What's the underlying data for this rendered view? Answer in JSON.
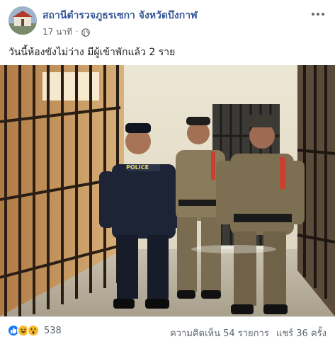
{
  "post": {
    "page_name": "สถานีตำรวจภูธรเซกา จังหวัดบึงกาฬ",
    "timestamp": "17 นาที",
    "visibility_icon": "globe-icon",
    "text": "วันนี้ห้องขังไม่ว่าง มีผู้เข้าพักแล้ว 2 ราย"
  },
  "photo": {
    "shirt_label": "POLICE"
  },
  "footer": {
    "reaction_icons": [
      "like-icon",
      "haha-icon",
      "wow-icon"
    ],
    "reaction_count": "538",
    "comments": "ความคิดเห็น 54 รายการ",
    "shares": "แชร์ 36 ครั้ง"
  },
  "colors": {
    "page_name": "#385898",
    "like": "#1877f2",
    "emoji": "#f7b928"
  }
}
